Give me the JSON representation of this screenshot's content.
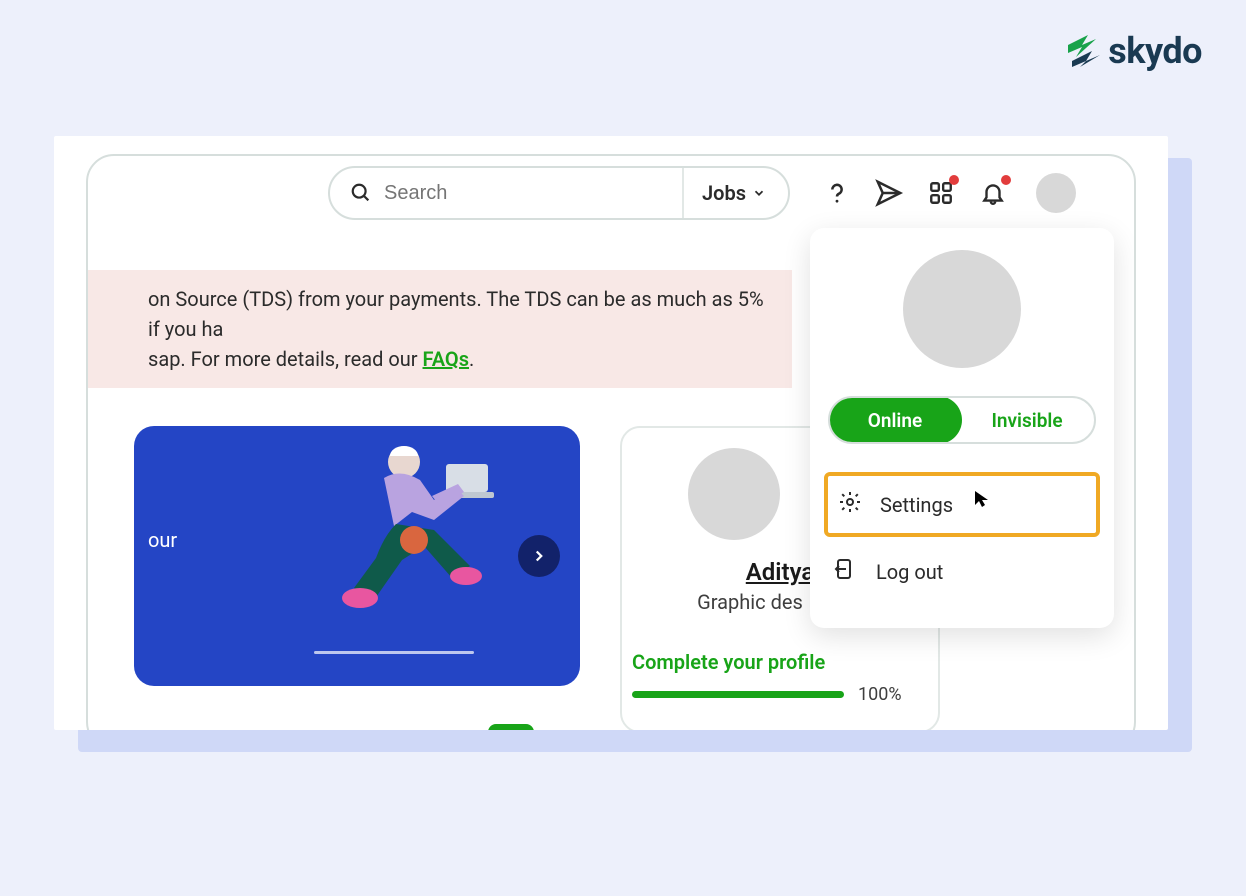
{
  "brand": {
    "name": "skydo"
  },
  "search": {
    "placeholder": "Search",
    "selector_label": "Jobs"
  },
  "banner": {
    "line1": "on Source (TDS) from your payments. The TDS can be as much as 5% if you ha",
    "line2_prefix": "sap. For more details, read our ",
    "faq_label": "FAQs",
    "line2_suffix": "."
  },
  "promo": {
    "partial_text": "our"
  },
  "profile_card": {
    "name": "Aditya ",
    "role": "Graphic des",
    "complete_label": "Complete your profile",
    "progress_pct": "100%"
  },
  "dropdown": {
    "status_online": "Online",
    "status_invisible": "Invisible",
    "settings_label": "Settings",
    "logout_label": "Log out"
  }
}
